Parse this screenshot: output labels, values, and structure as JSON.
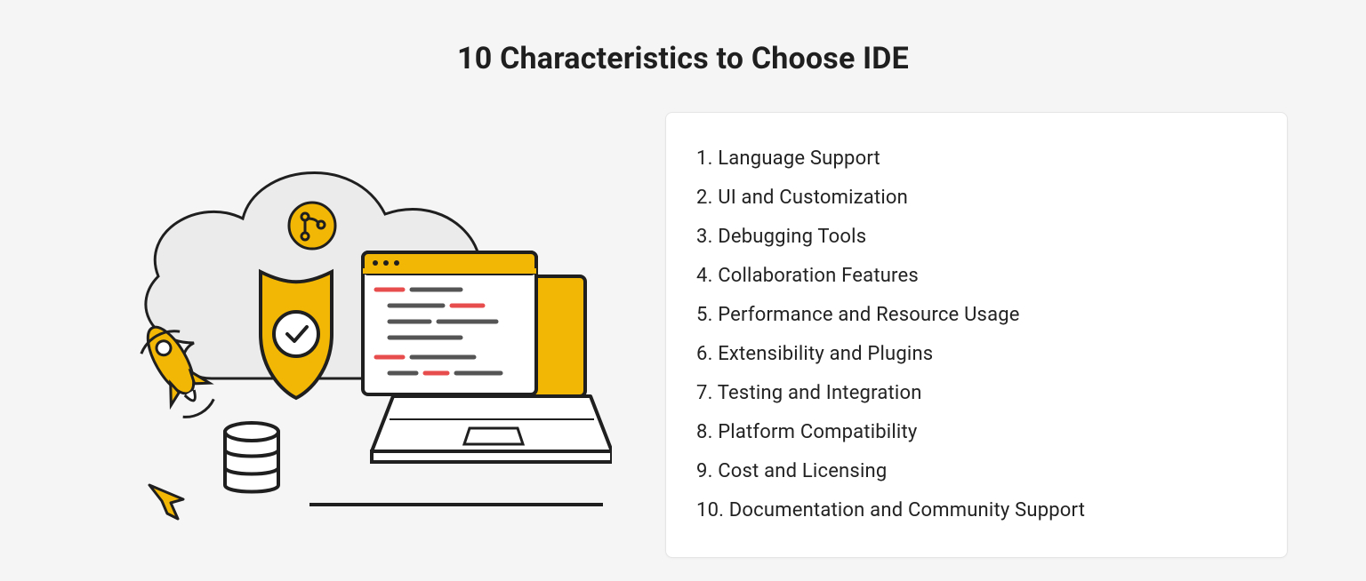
{
  "title": "10 Characteristics to Choose IDE",
  "items": [
    "1. Language Support",
    "2. UI and Customization",
    "3. Debugging Tools",
    "4. Collaboration Features",
    "5. Performance and Resource Usage",
    "6. Extensibility and Plugins",
    "7. Testing and Integration",
    "8. Platform Compatibility",
    "9. Cost and Licensing",
    "10. Documentation and Community Support"
  ],
  "colors": {
    "yellow": "#f2b705",
    "yellowLight": "#f7c948",
    "cloud": "#ebebeb",
    "stroke": "#1f1f1f",
    "white": "#ffffff",
    "red": "#e84d4d",
    "grayLine": "#555555"
  }
}
